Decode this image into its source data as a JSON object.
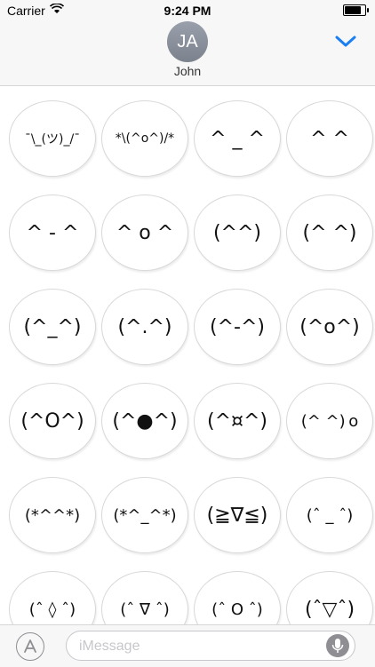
{
  "status_bar": {
    "carrier": "Carrier",
    "wifi_icon": "wifi-icon",
    "time": "9:24 PM",
    "battery_level": 0.9
  },
  "header": {
    "avatar_initials": "JA",
    "contact_name": "John",
    "collapse_icon": "chevron-down-icon",
    "accent_color": "#1a7ff0"
  },
  "stickers": [
    "¯\\_(ツ)_/¯",
    "*\\(^o^)/*",
    "^ _ ^",
    "^  ^",
    "^ - ^",
    "^ o ^",
    "(^^)",
    "(^ ^)",
    "(^_^)",
    "(^.^)",
    "(^-^)",
    "(^o^)",
    "(^O^)",
    "(^●^)",
    "(^¤^)",
    "(^ ^) o",
    "(*^^*)",
    "(*^_^*)",
    "(≧∇≦)",
    "(ˆ _ ˆ)",
    "(ˆ ◊ ˆ)",
    "(ˆ ∇ ˆ)",
    "(ˆ O ˆ)",
    "(ˆ▽ˆ)"
  ],
  "composer": {
    "placeholder": "iMessage",
    "apps_icon": "app-store-icon",
    "mic_icon": "microphone-icon"
  }
}
